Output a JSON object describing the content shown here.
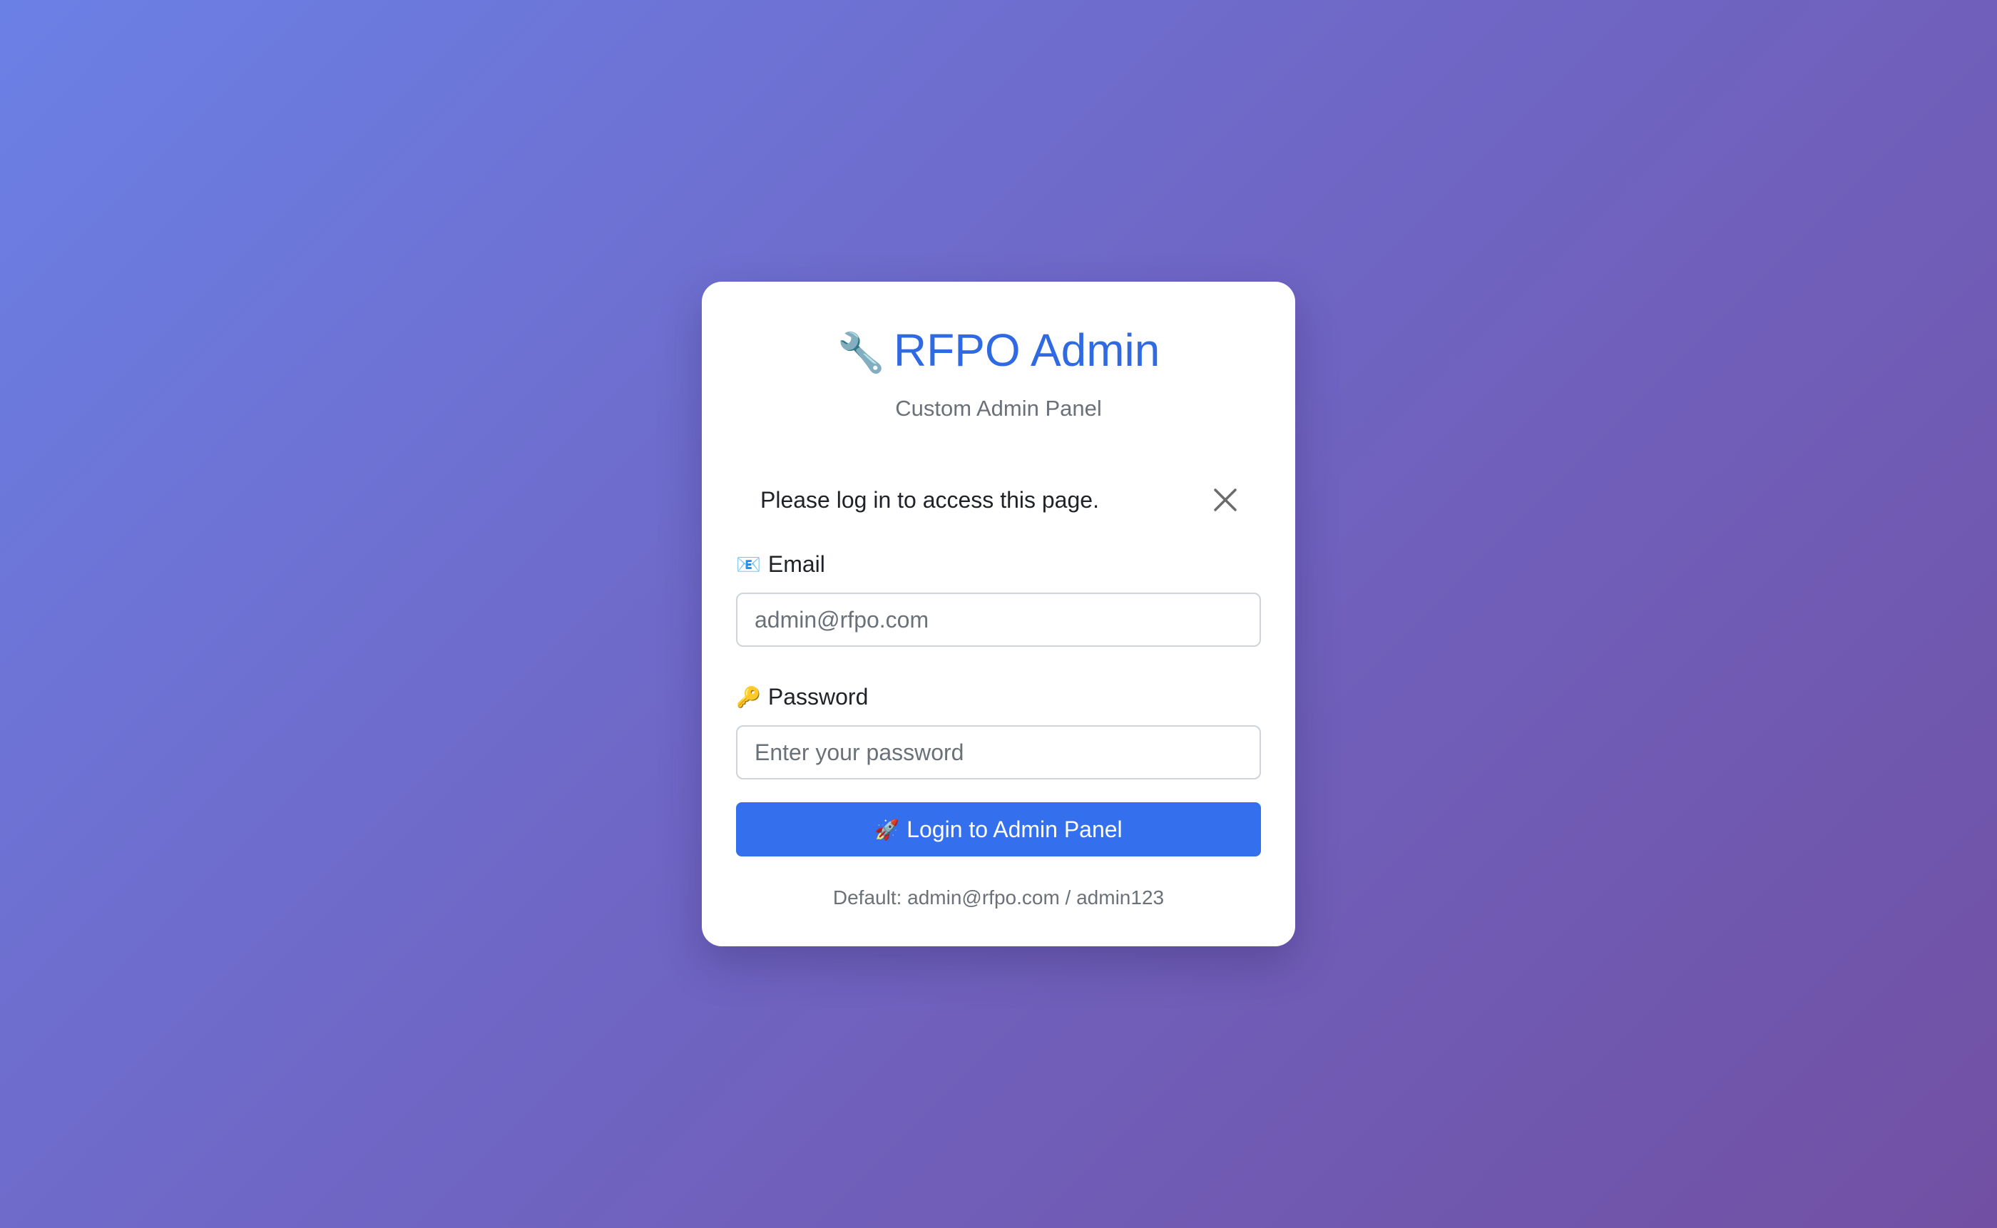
{
  "header": {
    "title_icon": "wrench-icon",
    "title_glyph": "🔧",
    "title": "RFPO Admin",
    "subtitle": "Custom Admin Panel"
  },
  "alert": {
    "message": "Please log in to access this page.",
    "close_icon": "close-icon"
  },
  "form": {
    "email": {
      "icon": "envelope-icon",
      "icon_glyph": "📧",
      "label": "Email",
      "value": "",
      "placeholder": "admin@rfpo.com"
    },
    "password": {
      "icon": "key-icon",
      "icon_glyph": "🔑",
      "label": "Password",
      "value": "",
      "placeholder": "Enter your password"
    },
    "submit": {
      "icon": "rocket-icon",
      "icon_glyph": "🚀",
      "label": "Login to Admin Panel"
    }
  },
  "footer": {
    "hint": "Default: admin@rfpo.com / admin123"
  },
  "colors": {
    "accent": "#2f6ae3",
    "button": "#3470ee",
    "background_start": "#6b80e5",
    "background_end": "#7150a3"
  }
}
